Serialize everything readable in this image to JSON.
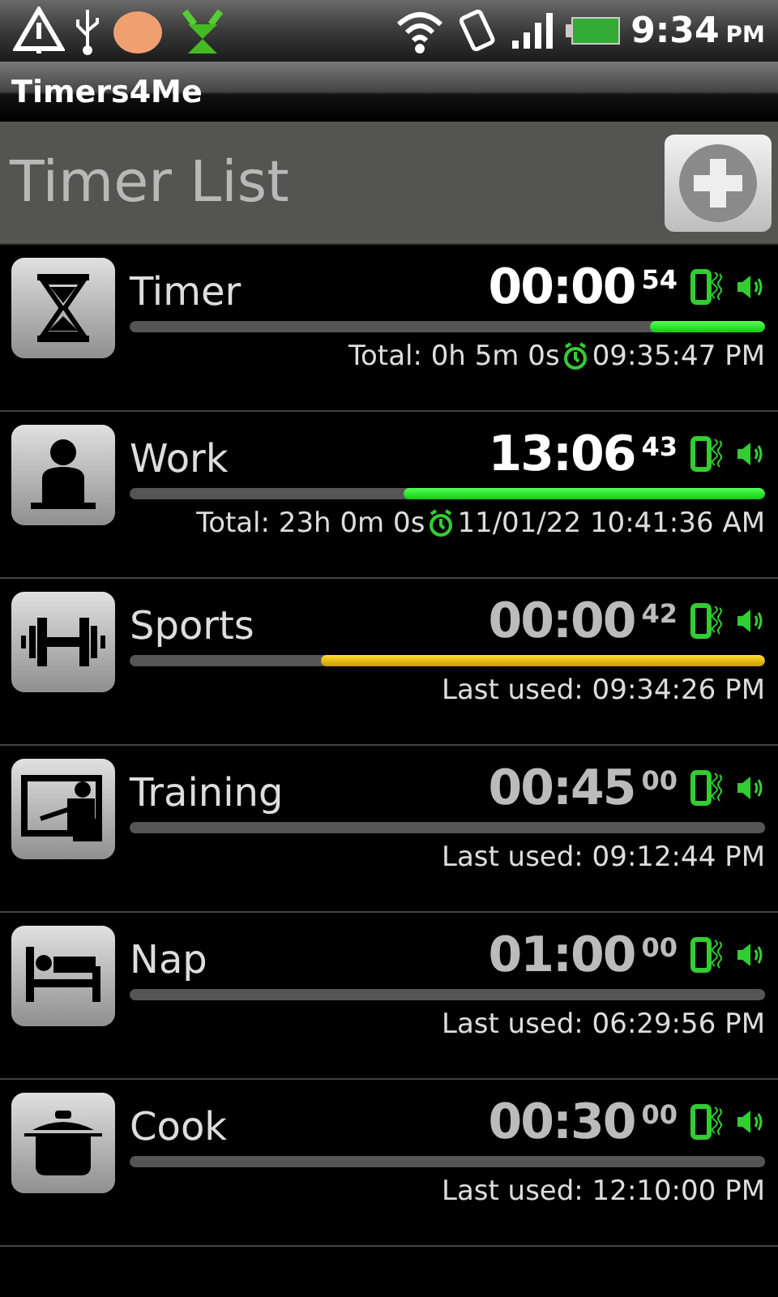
{
  "status_bar": {
    "time": "9:34",
    "ampm": "PM"
  },
  "app_title": "Timers4Me",
  "header": {
    "title": "Timer List"
  },
  "timers": [
    {
      "name": "Timer",
      "time": "00:00",
      "seconds": "54",
      "running": true,
      "paused": false,
      "level": 0.18,
      "vibrate": true,
      "sound": true,
      "footer": {
        "kind": "total",
        "total": "Total: 0h 5m 0s",
        "alarm": "09:35:47 PM"
      }
    },
    {
      "name": "Work",
      "time": "13:06",
      "seconds": "43",
      "running": true,
      "paused": false,
      "level": 0.57,
      "vibrate": true,
      "sound": true,
      "footer": {
        "kind": "total",
        "total": "Total: 23h 0m 0s",
        "alarm": "11/01/22 10:41:36 AM"
      }
    },
    {
      "name": "Sports",
      "time": "00:00",
      "seconds": "42",
      "running": false,
      "paused": true,
      "level": 0.7,
      "vibrate": true,
      "sound": true,
      "footer": {
        "kind": "last",
        "text": "Last used: 09:34:26 PM"
      }
    },
    {
      "name": "Training",
      "time": "00:45",
      "seconds": "00",
      "running": false,
      "paused": false,
      "level": 0,
      "vibrate": true,
      "sound": true,
      "footer": {
        "kind": "last",
        "text": "Last used: 09:12:44 PM"
      }
    },
    {
      "name": "Nap",
      "time": "01:00",
      "seconds": "00",
      "running": false,
      "paused": false,
      "level": 0,
      "vibrate": true,
      "sound": true,
      "footer": {
        "kind": "last",
        "text": "Last used: 06:29:56 PM"
      }
    },
    {
      "name": "Cook",
      "time": "00:30",
      "seconds": "00",
      "running": false,
      "paused": false,
      "level": 0,
      "vibrate": true,
      "sound": true,
      "footer": {
        "kind": "last",
        "text": "Last used: 12:10:00 PM"
      }
    }
  ]
}
